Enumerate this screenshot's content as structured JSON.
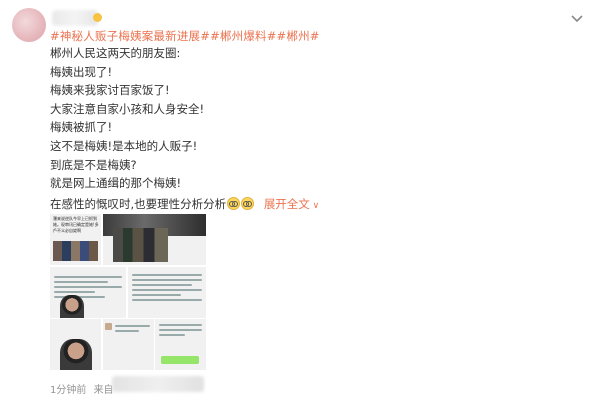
{
  "post": {
    "topics": "#神秘人贩子梅姨案最新进展##郴州爆料##郴州#",
    "lines": [
      "郴州人民这两天的朋友圈:",
      "梅姨出现了!",
      "梅姨来我家讨百家饭了!",
      "大家注意自家小孩和人身安全!",
      "梅姨被抓了!",
      "这不是梅姨!是本地的人贩子!",
      "到底是不是梅姨?",
      "就是网上通缉的那个梅姨!"
    ],
    "analysis_text": "在感性的慨叹时,也要理性分析分析",
    "expand_label": "展开全文",
    "expand_icon": "chevron-down-icon",
    "time_label": "1分钟前",
    "source_prefix": "来自"
  },
  "grid": {
    "cell1_caption": "瀑来说逆队今早上已抓到她。现审讯已确定是她!多戶不义必自毙啊"
  },
  "colors": {
    "topic": "#eb7350",
    "text": "#333333",
    "meta": "#939393",
    "chat_bubble": "#95e56b"
  }
}
